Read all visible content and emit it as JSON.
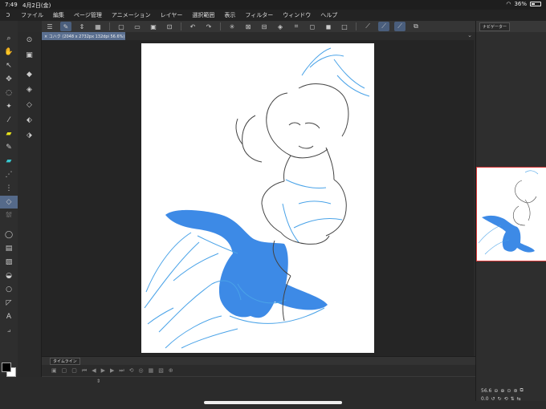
{
  "status_bar": {
    "time": "7:49",
    "date": "4月2日(金)",
    "battery": "36%"
  },
  "menu": [
    "ファイル",
    "編集",
    "ページ管理",
    "アニメーション",
    "レイヤー",
    "選択範囲",
    "表示",
    "フィルター",
    "ウィンドウ",
    "ヘルプ"
  ],
  "document": {
    "tab_label": "コハク (2048 x 2732px 132dpi 56.6%)"
  },
  "panels": {
    "navigator_label": "ナビゲーター"
  },
  "timeline": {
    "label": "タイムライン"
  },
  "navigator": {
    "zoom": "56.6",
    "angle": "0.0"
  },
  "colors": {
    "fill_blue": "#3d8ae6",
    "sketch_blue": "#4aa3e8",
    "lineart": "#444444",
    "selection_red": "#d93636"
  }
}
